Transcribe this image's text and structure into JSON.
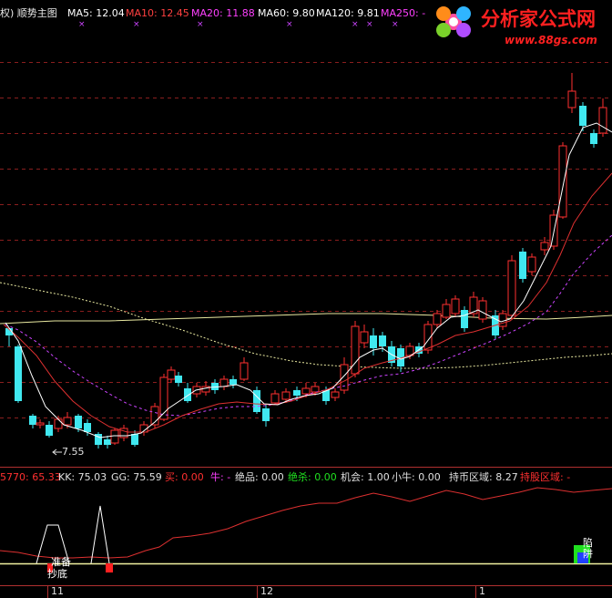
{
  "main_header": [
    {
      "text": "权) 顺势主图",
      "color": "#e8e8e8"
    },
    {
      "text": "MA5: 12.04",
      "color": "#ffffff"
    },
    {
      "text": "MA10: 12.45",
      "color": "#ff4040"
    },
    {
      "text": "MA20: 11.88",
      "color": "#ff40ff"
    },
    {
      "text": "MA60: 9.80",
      "color": "#ffffff"
    },
    {
      "text": "MA120: 9.81",
      "color": "#ffffff"
    },
    {
      "text": "MA250: -",
      "color": "#ff40ff"
    }
  ],
  "header_marker": "×",
  "logo": {
    "title": "分析家公式网",
    "url": "www.88gs.com"
  },
  "low_price_label": "7.55",
  "sub_header": [
    {
      "text": "5770: 65.33",
      "color": "#ff3030"
    },
    {
      "text": "KK: 75.03",
      "color": "#e0e0e0"
    },
    {
      "text": "GG: 75.59",
      "color": "#e0e0e0"
    },
    {
      "text": "买: 0.00",
      "color": "#ff3030"
    },
    {
      "text": "牛: -",
      "color": "#ff40ff"
    },
    {
      "text": "绝品: 0.00",
      "color": "#e0e0e0"
    },
    {
      "text": "绝杀: 0.00",
      "color": "#20e020"
    },
    {
      "text": "机会: 1.00",
      "color": "#e0e0e0"
    },
    {
      "text": "小牛: 0.00",
      "color": "#e0e0e0"
    },
    {
      "text": "持币区域: 8.27",
      "color": "#e0e0e0"
    },
    {
      "text": "持股区域: -",
      "color": "#ff3030"
    }
  ],
  "signal_labels": {
    "zhunbei": "准备",
    "chaodi": "抄底",
    "xianjing": "陷阱"
  },
  "time_axis": {
    "labels": [
      "11",
      "12",
      "1"
    ]
  },
  "colors": {
    "up": "#ff3030",
    "down": "#40e8f0",
    "grid": "#8a1e1e",
    "ma5": "#ffffff",
    "ma10": "#dd3030",
    "ma20": "#cc44ff",
    "ma60": "#e8e8a0"
  }
}
